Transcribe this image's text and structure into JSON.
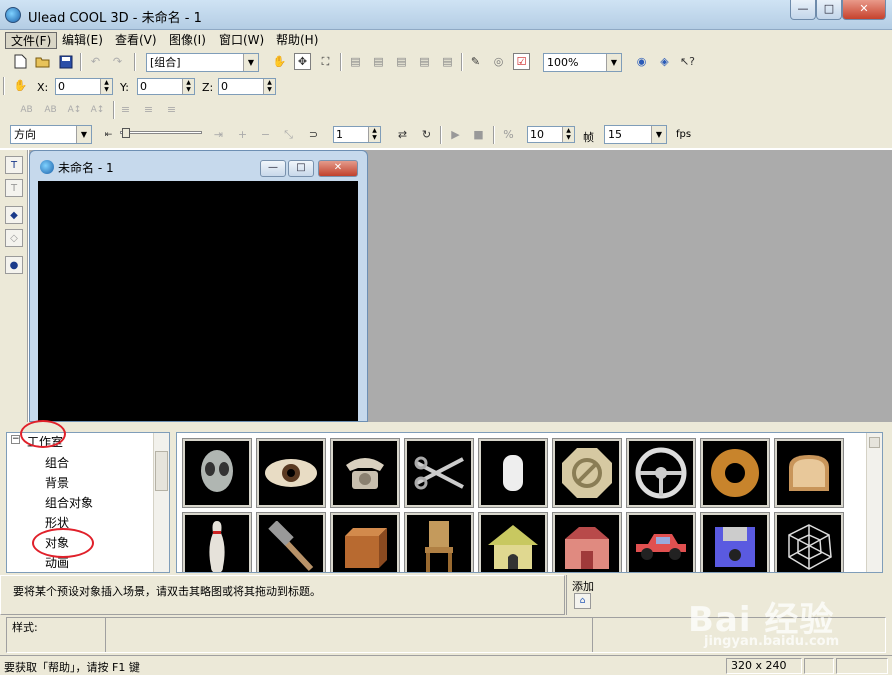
{
  "window": {
    "title": "Ulead COOL 3D - 未命名 - 1",
    "min_glyph": "—",
    "max_glyph": "□",
    "close_glyph": "✕"
  },
  "menu": [
    "文件(F)",
    "编辑(E)",
    "查看(V)",
    "图像(I)",
    "窗口(W)",
    "帮助(H)"
  ],
  "toolbar": {
    "object_combo": "[组合]",
    "zoom_combo": "100%"
  },
  "position": {
    "x_label": "X:",
    "x_value": "0",
    "y_label": "Y:",
    "y_value": "0",
    "z_label": "Z:",
    "z_value": "0"
  },
  "animation": {
    "attribute_combo": "方向",
    "frame_value": "1",
    "frames_value": "10",
    "frames_label": "帧",
    "fps_combo": "15",
    "fps_label": "fps"
  },
  "document": {
    "title": "未命名 - 1"
  },
  "tree": {
    "root": "工作室",
    "items": [
      "组合",
      "背景",
      "组合对象",
      "形状",
      "对象",
      "动画"
    ],
    "selected": "对象"
  },
  "thumbnails": {
    "row1": [
      "alien-head",
      "eye",
      "telephone",
      "scissors",
      "tooth",
      "stop-sign",
      "steering-wheel",
      "donut",
      "bread"
    ],
    "row2": [
      "bowling-pin",
      "hammer",
      "wooden-box",
      "chair",
      "dog-house",
      "barn",
      "car",
      "floppy-disk",
      "spider-web"
    ]
  },
  "hint": {
    "text": "要将某个预设对象插入场景，请双击其略图或将其拖动到标题。"
  },
  "add": {
    "label": "添加"
  },
  "style": {
    "label": "样式:"
  },
  "status": {
    "help": "要获取「帮助」，请按 F1 键",
    "size": "320 x 240"
  },
  "watermark": {
    "brand": "Bai 经验",
    "url": "jingyan.baidu.com"
  },
  "colors": {
    "highlight_ring": "#e0202a",
    "titlebar": "#b4cde4",
    "canvas": "#000000"
  }
}
